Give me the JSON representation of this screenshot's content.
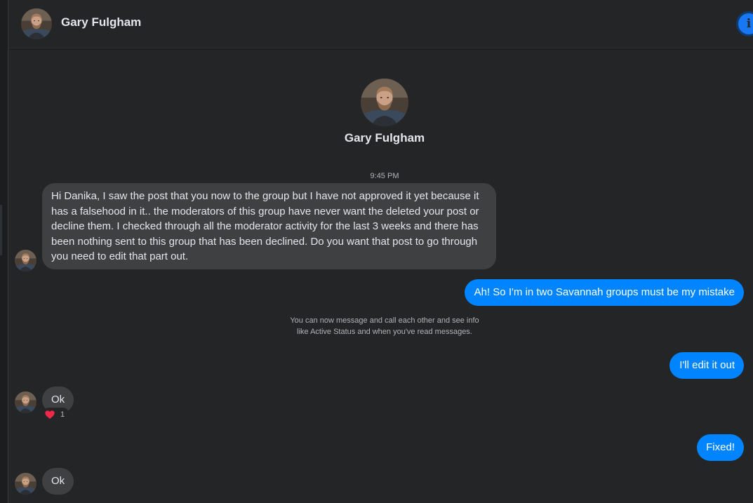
{
  "contact": {
    "name": "Gary Fulgham"
  },
  "profile": {
    "name": "Gary Fulgham"
  },
  "conversation": {
    "timestamp": "9:45 PM",
    "notice": "You can now message and call each other and see info like Active Status and when you've read messages.",
    "messages": [
      {
        "direction": "incoming",
        "text": "Hi Danika, I saw the post that you now to the group but I have not approved it yet because it has a falsehood in it.. the moderators of this group have never want the deleted your post or decline them. I checked through all the moderator activity for the last 3 weeks and there has been nothing sent to this group that has been declined. Do you want that post to go through you need to edit that part out."
      },
      {
        "direction": "outgoing",
        "text": "Ah! So I'm in two Savannah groups must be my mistake"
      },
      {
        "direction": "outgoing",
        "text": "I'll edit it out"
      },
      {
        "direction": "incoming",
        "text": "Ok",
        "reaction": {
          "emoji": "heart",
          "count": "1"
        }
      },
      {
        "direction": "outgoing",
        "text": "Fixed!"
      },
      {
        "direction": "incoming",
        "text": "Ok"
      }
    ]
  },
  "icons": {
    "info": "info-icon",
    "reaction": "heart-icon"
  },
  "colors": {
    "background": "#242526",
    "incoming_bubble": "#3e4042",
    "outgoing_bubble": "#0084ff",
    "accent": "#1877f2",
    "muted_text": "#b0b3b8",
    "primary_text": "#e4e6eb",
    "heart": "#f02849"
  }
}
